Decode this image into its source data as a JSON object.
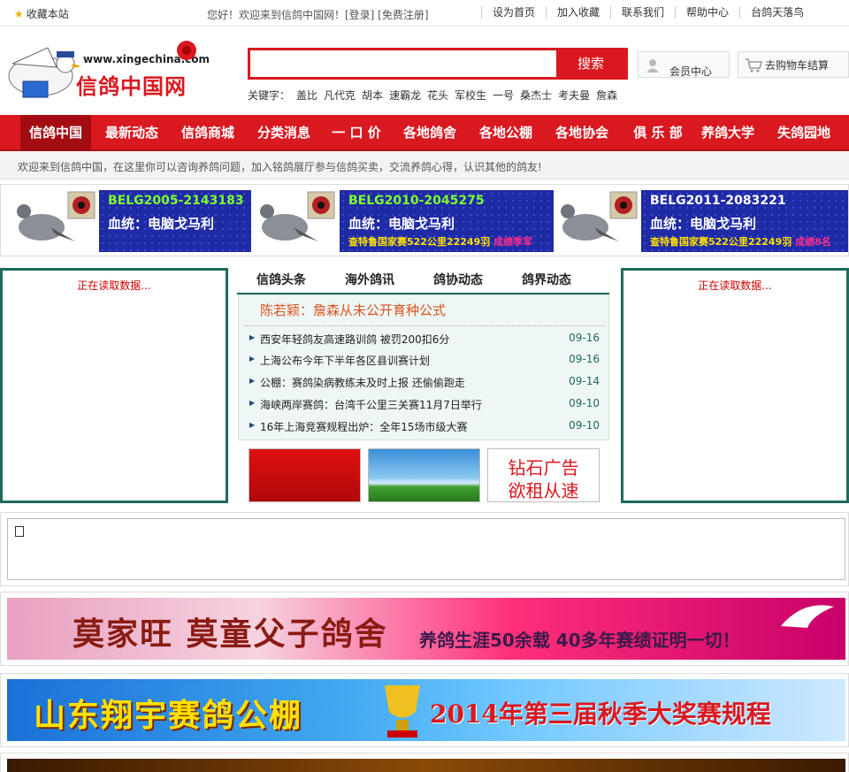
{
  "topbar": {
    "favorite": "收藏本站",
    "welcome": "您好！欢迎来到信鸽中国网！[登录] [免费注册]",
    "links": [
      "设为首页",
      "加入收藏",
      "联系我们",
      "帮助中心",
      "台鸽天落鸟"
    ]
  },
  "logo": {
    "url_text": "www.xingechina.com",
    "name": "信鸽中国网"
  },
  "search": {
    "value": "",
    "button": "搜索",
    "keyword_label": "关键字：",
    "keywords": [
      "盖比",
      "凡代克",
      "胡本",
      "速霸龙",
      "花头",
      "军校生",
      "一号",
      "桑杰士",
      "考夫曼",
      "詹森"
    ]
  },
  "member": {
    "label": "会员中心"
  },
  "cart": {
    "label": "去购物车结算"
  },
  "nav": [
    "信鸽中国",
    "最新动态",
    "信鸽商城",
    "分类消息",
    "一 口 价",
    "各地鸽舍",
    "各地公棚",
    "各地协会",
    "俱 乐 部",
    "养鸽大学",
    "失鸽园地"
  ],
  "subwelcome": "欢迎来到信鸽中国，在这里你可以咨询养鸽问题，加入铭鸽展厅参与信鸽买卖，交流养鸽心得，认识其他的鸽友!",
  "ads": [
    {
      "ring": "BELG2005-2143183",
      "line2": "血统：电脑戈马利",
      "line3": "",
      "line3b": ""
    },
    {
      "ring": "BELG2010-2045275",
      "line2": "血统：电脑戈马利",
      "line3": "查特鲁国家赛522公里22249羽",
      "line3b": "成绩季军"
    },
    {
      "ring": "BELG2011-2083221",
      "line2": "血统：电脑戈马利",
      "line3": "查特鲁国家赛522公里22249羽",
      "line3b": "成绩8名"
    }
  ],
  "loading": "正在读取数据...",
  "tabs": [
    "信鸽头条",
    "海外鸽讯",
    "鸽协动态",
    "鸽界动态"
  ],
  "headline": "陈若颖：詹森从未公开育种公式",
  "news": [
    {
      "title": "西安年轻鸽友高速路训鸽 被罚200扣6分",
      "date": "09-16"
    },
    {
      "title": "上海公布今年下半年各区县训赛计划",
      "date": "09-16"
    },
    {
      "title": "公棚：赛鸽染病教练未及时上报 还偷偷跑走",
      "date": "09-14"
    },
    {
      "title": "海峡两岸赛鸽：台湾千公里三关赛11月7日举行",
      "date": "09-10"
    },
    {
      "title": "16年上海竞赛规程出炉：全年15场市级大赛",
      "date": "09-10"
    }
  ],
  "diamond_ad": {
    "line1": "钻石广告",
    "line2": "欲租从速"
  },
  "banners": {
    "b1": {
      "main": "莫家旺 莫童父子鸽舍",
      "sub": "养鸽生涯50余载 40多年赛绩证明一切！"
    },
    "b2": {
      "main": "山东翔宇赛鸽公棚",
      "sub": "2014年第三届秋季大奖赛规程"
    }
  },
  "colors": {
    "brand_red": "#d9181f",
    "dark_teal": "#1f6a5e"
  }
}
